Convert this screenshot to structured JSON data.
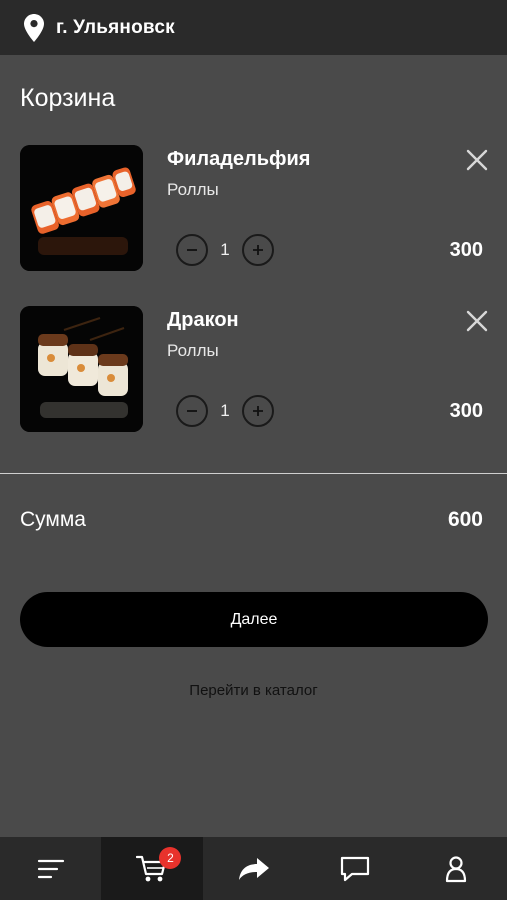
{
  "header": {
    "city": "г. Ульяновск",
    "icon": "location-pin-icon"
  },
  "page": {
    "title": "Корзина"
  },
  "cart": {
    "items": [
      {
        "name": "Филадельфия",
        "category": "Роллы",
        "quantity": "1",
        "price": "300"
      },
      {
        "name": "Дракон",
        "category": "Роллы",
        "quantity": "1",
        "price": "300"
      }
    ]
  },
  "summary": {
    "label": "Сумма",
    "total": "600"
  },
  "actions": {
    "next_label": "Далее",
    "catalog_label": "Перейти в каталог"
  },
  "bottom_nav": {
    "cart_badge": "2",
    "tabs": [
      "menu-icon",
      "cart-icon",
      "share-icon",
      "chat-icon",
      "profile-icon"
    ]
  },
  "colors": {
    "background": "#4a4a4a",
    "bar": "#2a2a2a",
    "button": "#000000",
    "badge": "#e8322c"
  }
}
